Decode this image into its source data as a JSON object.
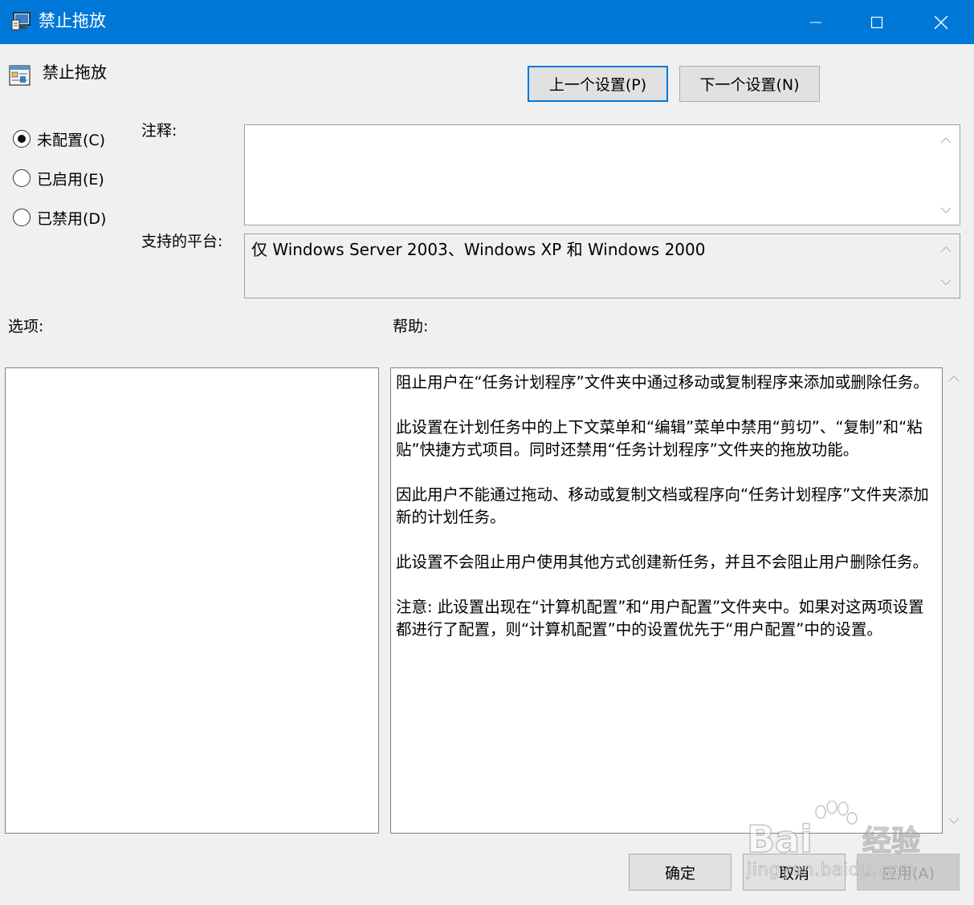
{
  "window": {
    "title": "禁止拖放",
    "accent_color": "#0078d7",
    "icons": {
      "app": "policy-editor-icon",
      "minimize": "minimize-icon",
      "maximize": "maximize-icon",
      "close": "close-icon"
    }
  },
  "policy": {
    "name": "禁止拖放",
    "icon": "policy-settings-icon"
  },
  "nav": {
    "prev_label": "上一个设置(P)",
    "next_label": "下一个设置(N)"
  },
  "state": {
    "options": [
      {
        "label": "未配置(C)",
        "checked": true
      },
      {
        "label": "已启用(E)",
        "checked": false
      },
      {
        "label": "已禁用(D)",
        "checked": false
      }
    ]
  },
  "comment": {
    "label": "注释:",
    "value": ""
  },
  "platform": {
    "label": "支持的平台:",
    "value": "仅 Windows Server 2003、Windows XP 和 Windows 2000"
  },
  "options_panel": {
    "label": "选项:"
  },
  "help": {
    "label": "帮助:",
    "paragraphs": [
      "阻止用户在“任务计划程序”文件夹中通过移动或复制程序来添加或删除任务。",
      "此设置在计划任务中的上下文菜单和“编辑”菜单中禁用“剪切”、“复制”和“粘贴”快捷方式项目。同时还禁用“任务计划程序”文件夹的拖放功能。",
      "因此用户不能通过拖动、移动或复制文档或程序向“任务计划程序”文件夹添加新的计划任务。",
      "此设置不会阻止用户使用其他方式创建新任务，并且不会阻止用户删除任务。",
      "注意: 此设置出现在“计算机配置”和“用户配置”文件夹中。如果对这两项设置都进行了配置，则“计算机配置”中的设置优先于“用户配置”中的设置。"
    ]
  },
  "footer": {
    "ok_label": "确定",
    "cancel_label": "取消",
    "apply_label": "应用(A)"
  },
  "watermark": {
    "brand": "Baidu经验",
    "url": "jingyan.baidu.com"
  }
}
